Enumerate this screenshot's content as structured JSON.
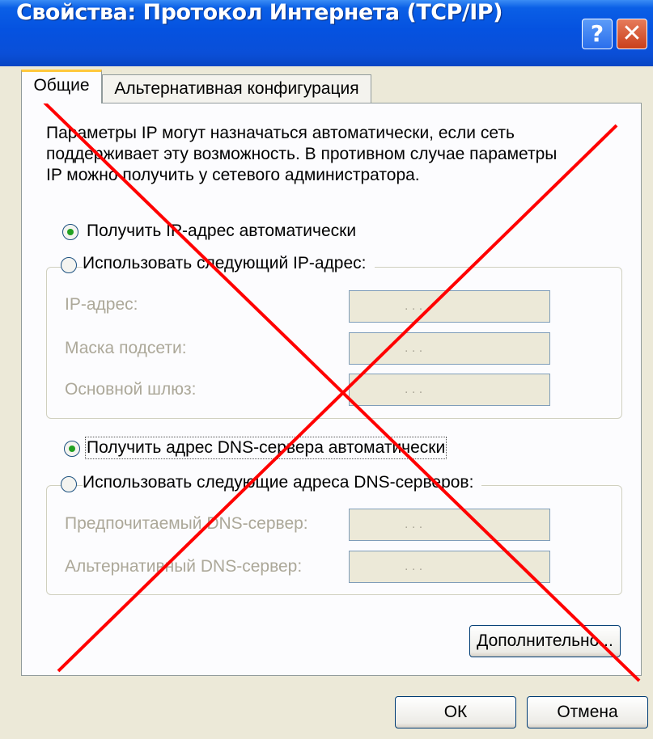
{
  "window": {
    "title": "Свойства: Протокол Интернета (TCP/IP)",
    "help_glyph": "?",
    "close_glyph": "✕"
  },
  "tabs": [
    {
      "label": "Общие",
      "active": true
    },
    {
      "label": "Альтернативная конфигурация",
      "active": false
    }
  ],
  "description": [
    "Параметры IP могут назначаться автоматически, если сеть",
    "поддерживает эту возможность. В противном случае параметры",
    "IP можно получить у сетевого администратора."
  ],
  "ip": {
    "auto_label": "Получить IP-адрес автоматически",
    "manual_label": "Использовать следующий IP-адрес:",
    "selected": "auto",
    "fields": [
      {
        "label": "IP-адрес:",
        "value": ". . ."
      },
      {
        "label": "Маска подсети:",
        "value": ". . ."
      },
      {
        "label": "Основной шлюз:",
        "value": ". . ."
      }
    ]
  },
  "dns": {
    "auto_label": "Получить адрес DNS-сервера автоматически",
    "manual_label": "Использовать следующие адреса DNS-серверов:",
    "selected": "auto",
    "fields": [
      {
        "label": "Предпочитаемый DNS-сервер:",
        "value": ". . ."
      },
      {
        "label": "Альтернативный DNS-сервер:",
        "value": ". . ."
      }
    ]
  },
  "buttons": {
    "advanced": "Дополнительно...",
    "ok": "ОК",
    "cancel": "Отмена"
  },
  "overlay": {
    "type": "red-cross",
    "color": "#FF0000"
  }
}
